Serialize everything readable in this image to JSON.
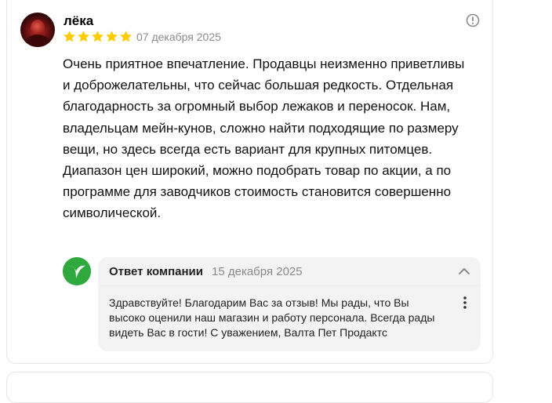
{
  "review": {
    "author": "лёка",
    "rating": 5,
    "rating_max": 5,
    "date": "07 декабря 2025",
    "text": "Очень приятное впечатление. Продавцы неизменно приветливы и доброжелательны, что сейчас большая редкость. Отдельная благодарность за огромный выбор лежаков и переносок. Нам, владельцам мейн-кунов, сложно найти подходящие по размеру вещи, но здесь всегда есть вариант для крупных питомцев. Диапазон цен широкий, можно подобрать товар по акции, а по программе для заводчиков стоимость становится совершенно символической."
  },
  "reply": {
    "title": "Ответ компании",
    "date": "15 декабря 2025",
    "text": "Здравствуйте! Благодарим Вас за отзыв! Мы рады, что Вы высоко оценили наш магазин и работу персонала. Всегда рады видеть Вас в гости! С уважением, Валта Пет Продактс"
  },
  "icons": {
    "star": "star-icon",
    "info": "info-icon",
    "chevron": "chevron-up-icon",
    "menu": "kebab-menu-icon",
    "company_logo": "company-logo"
  },
  "colors": {
    "star": "#fc0",
    "brand_green": "#2fa83e",
    "reply_bg": "#f3f3f3",
    "muted_text": "#8a8a8a"
  }
}
